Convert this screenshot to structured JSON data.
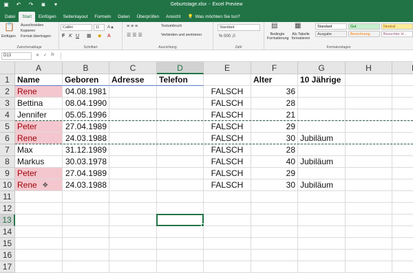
{
  "window": {
    "file_name": "Geburtstage.xlsx",
    "app_name": "Excel Preview",
    "separator": "-"
  },
  "tabs": [
    {
      "label": "Datei"
    },
    {
      "label": "Start"
    },
    {
      "label": "Einfügen"
    },
    {
      "label": "Seitenlayout"
    },
    {
      "label": "Formeln"
    },
    {
      "label": "Daten"
    },
    {
      "label": "Überprüfen"
    },
    {
      "label": "Ansicht"
    }
  ],
  "tell_me": "Was möchten Sie tun?",
  "ribbon": {
    "clipboard": {
      "paste": "Einfügen",
      "cut": "Ausschneiden",
      "copy": "Kopieren",
      "format_painter": "Format übertragen",
      "label": "Zwischenablage"
    },
    "font": {
      "name": "Calibri",
      "size": "11",
      "bold": "F",
      "italic": "K",
      "underline": "U",
      "label": "Schriftart"
    },
    "alignment": {
      "wrap": "Textumbruch",
      "merge": "Verbinden und zentrieren",
      "label": "Ausrichtung"
    },
    "number": {
      "format": "Standard",
      "label": "Zahl"
    },
    "styles": {
      "conditional": "Bedingte Formatierung",
      "as_table": "Als Tabelle formatieren",
      "cells": [
        {
          "label": "Standard",
          "bg": "#ffffff",
          "fg": "#000000"
        },
        {
          "label": "Gut",
          "bg": "#c6efce",
          "fg": "#006100"
        },
        {
          "label": "Neutral",
          "bg": "#ffeb9c",
          "fg": "#9c5700"
        },
        {
          "label": "Ausgabe",
          "bg": "#f2f2f2",
          "fg": "#3f3f3f"
        },
        {
          "label": "Berechnung",
          "bg": "#f2f2f2",
          "fg": "#fa7d00"
        },
        {
          "label": "Besuchter H...",
          "bg": "#ffffff",
          "fg": "#954f72"
        }
      ],
      "label": "Formatvorlagen"
    }
  },
  "formula_bar": {
    "name_box": "D13",
    "fx": "fx"
  },
  "columns": [
    "A",
    "B",
    "C",
    "D",
    "E",
    "F",
    "G",
    "H",
    "I"
  ],
  "selected_column": "D",
  "selected_row": "13",
  "rows": [
    "1",
    "2",
    "3",
    "4",
    "5",
    "6",
    "7",
    "8",
    "9",
    "10",
    "11",
    "12",
    "13",
    "14",
    "15",
    "16",
    "17"
  ],
  "sheet": {
    "header": [
      "Name",
      "Geboren",
      "Adresse",
      "Telefon",
      "",
      "Alter",
      "10 Jährige"
    ],
    "records": [
      {
        "name": "Rene",
        "born": "04.08.1981",
        "e": "FALSCH",
        "age": "36",
        "jub": "",
        "hl": true
      },
      {
        "name": "Bettina",
        "born": "08.04.1990",
        "e": "FALSCH",
        "age": "28",
        "jub": "",
        "hl": false
      },
      {
        "name": "Jennifer",
        "born": "05.05.1996",
        "e": "FALSCH",
        "age": "21",
        "jub": "",
        "hl": false
      },
      {
        "name": "Peter",
        "born": "27.04.1989",
        "e": "FALSCH",
        "age": "29",
        "jub": "",
        "hl": true
      },
      {
        "name": "Rene",
        "born": "24.03.1988",
        "e": "FALSCH",
        "age": "30",
        "jub": "Jubiläum",
        "hl": true
      },
      {
        "name": "Max",
        "born": "31.12.1989",
        "e": "FALSCH",
        "age": "28",
        "jub": "",
        "hl": false
      },
      {
        "name": "Markus",
        "born": "30.03.1978",
        "e": "FALSCH",
        "age": "40",
        "jub": "Jubiläum",
        "hl": false
      },
      {
        "name": "Peter",
        "born": "27.04.1989",
        "e": "FALSCH",
        "age": "29",
        "jub": "",
        "hl": true
      },
      {
        "name": "Rene",
        "born": "24.03.1988",
        "e": "FALSCH",
        "age": "30",
        "jub": "Jubiläum",
        "hl": true
      }
    ]
  },
  "colors": {
    "accent": "#217346",
    "duplicate_fill": "#f4c7ce",
    "duplicate_text": "#9c0006"
  }
}
